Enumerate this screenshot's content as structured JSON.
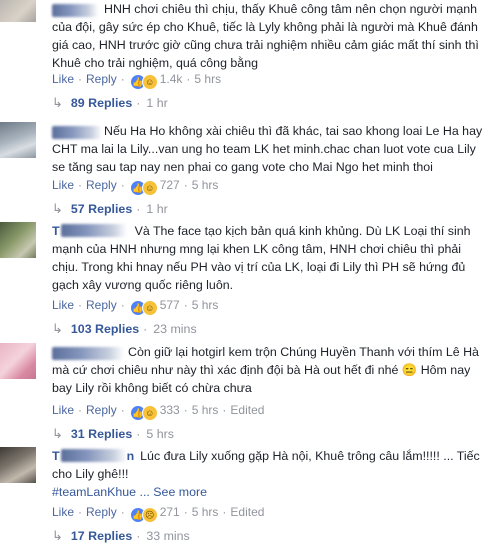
{
  "comments": [
    {
      "text": "HNH chơi chiêu thì chịu, thấy Khuê công tâm nên chọn người mạnh của đội, gây sức ép cho Khuê, tiếc là Lyly không phải là người mà Khuê đánh giá cao, HNH trước giờ cũng chưa trải nghiệm nhiều cảm giác mất thí sinh thì Khuê cho trải nghiệm, quá công bằng",
      "like": "Like",
      "reply": "Reply",
      "reaction_count": "1.4k",
      "time": "5 hrs",
      "edited": "",
      "replies_label": "89 Replies",
      "replies_time": "1 hr"
    },
    {
      "text": "Nếu Ha Ho không xài chiêu thì đã khác, tai sao khong loai Le Ha hay CHT ma lai la Lily...van ung ho team LK het minh.chac chan luot vote cua Lily se tăng sau tap nay nen phai co gang vote cho Mai Ngo het minh thoi",
      "like": "Like",
      "reply": "Reply",
      "reaction_count": "727",
      "time": "5 hrs",
      "edited": "",
      "replies_label": "57 Replies",
      "replies_time": "1 hr"
    },
    {
      "name_fragment": "T",
      "text": "Và The face tạo kịch bản quá kinh khủng. Dù LK Loại thí sinh mạnh của HNH nhưng mng lại khen LK công tâm, HNH chơi chiêu thì phải chịu. Trong khi hnay nếu PH vào vị trí của LK, loại đi Lily thì PH sẽ hứng đủ gạch xây vương quốc riêng luôn.",
      "like": "Like",
      "reply": "Reply",
      "reaction_count": "577",
      "time": "5 hrs",
      "edited": "",
      "replies_label": "103 Replies",
      "replies_time": "23 mins"
    },
    {
      "text": "Còn giữ lại hotgirl kem trộn Chúng Huyền Thanh với thím Lê Hà mà cứ chơi chiêu như này thì xác định đội bà Hà out hết đi nhé 😑 Hôm nay bay Lily rồi không biết có chừa chưa",
      "like": "Like",
      "reply": "Reply",
      "reaction_count": "333",
      "time": "5 hrs",
      "edited": "Edited",
      "replies_label": "31 Replies",
      "replies_time": "5 hrs"
    },
    {
      "name_fragment": "T",
      "name_suffix": "n",
      "text": "Lúc đưa Lily xuống gặp Hà nội, Khuê trông câu lắm!!!!! ... Tiếc cho Lily ghê!!!",
      "hashtag": "#teamLanKhue",
      "see_more": "... See more",
      "like": "Like",
      "reply": "Reply",
      "reaction_count": "271",
      "time": "5 hrs",
      "edited": "Edited",
      "replies_label": "17 Replies",
      "replies_time": "33 mins"
    }
  ],
  "icons": {
    "like": "like-reaction-icon",
    "haha": "haha-reaction-icon",
    "sad": "sad-reaction-icon",
    "reply_arrow": "reply-arrow-icon"
  },
  "colors": {
    "link": "#365899",
    "meta": "#90949c",
    "text": "#1d2129"
  }
}
